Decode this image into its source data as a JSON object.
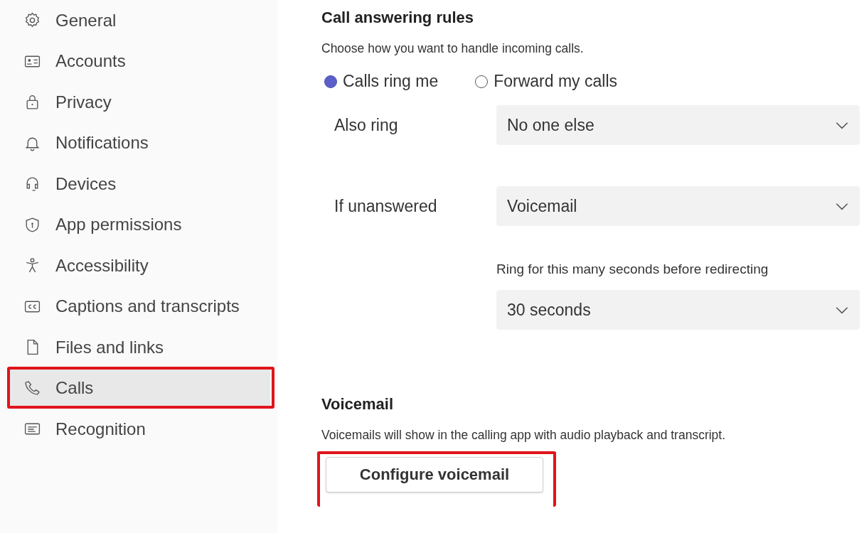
{
  "sidebar": {
    "items": [
      {
        "label": "General",
        "selected": false,
        "annotated": false
      },
      {
        "label": "Accounts",
        "selected": false,
        "annotated": false
      },
      {
        "label": "Privacy",
        "selected": false,
        "annotated": false
      },
      {
        "label": "Notifications",
        "selected": false,
        "annotated": false
      },
      {
        "label": "Devices",
        "selected": false,
        "annotated": false
      },
      {
        "label": "App permissions",
        "selected": false,
        "annotated": false
      },
      {
        "label": "Accessibility",
        "selected": false,
        "annotated": false
      },
      {
        "label": "Captions and transcripts",
        "selected": false,
        "annotated": false
      },
      {
        "label": "Files and links",
        "selected": false,
        "annotated": false
      },
      {
        "label": "Calls",
        "selected": true,
        "annotated": true
      },
      {
        "label": "Recognition",
        "selected": false,
        "annotated": false
      }
    ]
  },
  "call_answering": {
    "title": "Call answering rules",
    "description": "Choose how you want to handle incoming calls.",
    "options": [
      {
        "label": "Calls ring me",
        "selected": true
      },
      {
        "label": "Forward my calls",
        "selected": false
      }
    ],
    "also_ring": {
      "label": "Also ring",
      "value": "No one else"
    },
    "if_unanswered": {
      "label": "If unanswered",
      "value": "Voicemail"
    },
    "ring_duration": {
      "label": "Ring for this many seconds before redirecting",
      "value": "30 seconds"
    }
  },
  "voicemail": {
    "title": "Voicemail",
    "description": "Voicemails will show in the calling app with audio playback and transcript.",
    "button": {
      "label": "Configure voicemail",
      "annotated": true
    }
  }
}
